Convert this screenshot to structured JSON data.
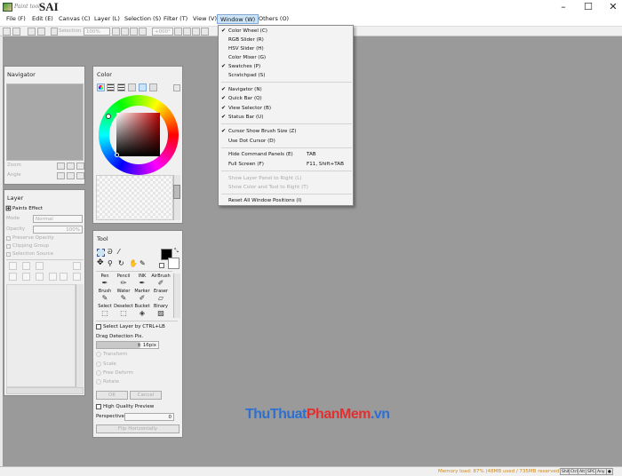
{
  "app": {
    "title_small": "Paint tool",
    "title_big": "SAI"
  },
  "window_controls": {
    "minimize": "–",
    "maximize": "☐",
    "close": "✕"
  },
  "menu": [
    "File (F)",
    "Edit (E)",
    "Canvas (C)",
    "Layer (L)",
    "Selection (S)",
    "Filter (T)",
    "View (V)",
    "Window (W)",
    "Others (O)"
  ],
  "toolbar": {
    "selection_label": "Selection",
    "zoom": "100%",
    "rotation": "+000°"
  },
  "window_menu": {
    "items": [
      {
        "label": "Color Wheel (C)",
        "checked": true
      },
      {
        "label": "RGB Slider (R)",
        "checked": false
      },
      {
        "label": "HSV Slider (H)",
        "checked": false
      },
      {
        "label": "Color Mixer (G)",
        "checked": false
      },
      {
        "label": "Swatches (P)",
        "checked": true
      },
      {
        "label": "Scratchpad (S)",
        "checked": false
      },
      {
        "label": "Navigator (N)",
        "checked": true
      },
      {
        "label": "Quick Bar (Q)",
        "checked": true
      },
      {
        "label": "View Selector (B)",
        "checked": true
      },
      {
        "label": "Status Bar (U)",
        "checked": true
      },
      {
        "label": "Cursor Show Brush Size (Z)",
        "checked": true
      },
      {
        "label": "Use Dot Cursor (D)",
        "checked": false
      },
      {
        "label": "Hide Command Panels (E)",
        "shortcut": "TAB"
      },
      {
        "label": "Full Screen (F)",
        "shortcut": "F11, Shift+TAB"
      },
      {
        "label": "Show Layer Panel to Right (L)",
        "disabled": true
      },
      {
        "label": "Show Color and Tool to Right (T)",
        "disabled": true
      },
      {
        "label": "Reset All Window Positions (I)"
      }
    ]
  },
  "navigator": {
    "title": "Navigator",
    "zoom_label": "Zoom",
    "angle_label": "Angle"
  },
  "layer": {
    "title": "Layer",
    "paints_effect": "Paints Effect",
    "mode_label": "Mode",
    "mode_value": "Normal",
    "opacity_label": "Opacity",
    "opacity_value": "100%",
    "checks": [
      "Preserve Opacity",
      "Clipping Group",
      "Selection Source"
    ]
  },
  "color": {
    "title": "Color"
  },
  "tool": {
    "title": "Tool",
    "brushes_row1": [
      "Pen",
      "Pencil",
      "INK",
      "AirBrush"
    ],
    "brushes_row2": [
      "Brush",
      "Water",
      "Marker",
      "Eraser"
    ],
    "brushes_row3": [
      "Select",
      "Deselect",
      "Bucket",
      "Binary"
    ],
    "select_layer": "Select Layer by CTRL+LB",
    "drag_detection": "Drag Detection Pix.",
    "drag_value": "± 16pix",
    "transform_options": [
      "Transform",
      "Scale",
      "Free Deform",
      "Rotate"
    ],
    "ok": "OK",
    "cancel": "Cancel",
    "hq_preview": "High Quality Preview",
    "perspective_label": "Perspective",
    "perspective_value": "0",
    "flip": "Flip Horizontally"
  },
  "status": {
    "memory": "Memory load: 87% (48MB used / 735MB reserved)",
    "buttons": [
      "Shift",
      "Ctrl",
      "Alt",
      "SPC",
      "Any",
      "●"
    ]
  },
  "watermark": {
    "part1": "ThuThuat",
    "part2": "PhanMem",
    "part3": ".vn"
  },
  "colors": {
    "workspace": "#9a9a9a",
    "memory_text": "#d08a1a",
    "menu_active": "#cde4f7"
  }
}
